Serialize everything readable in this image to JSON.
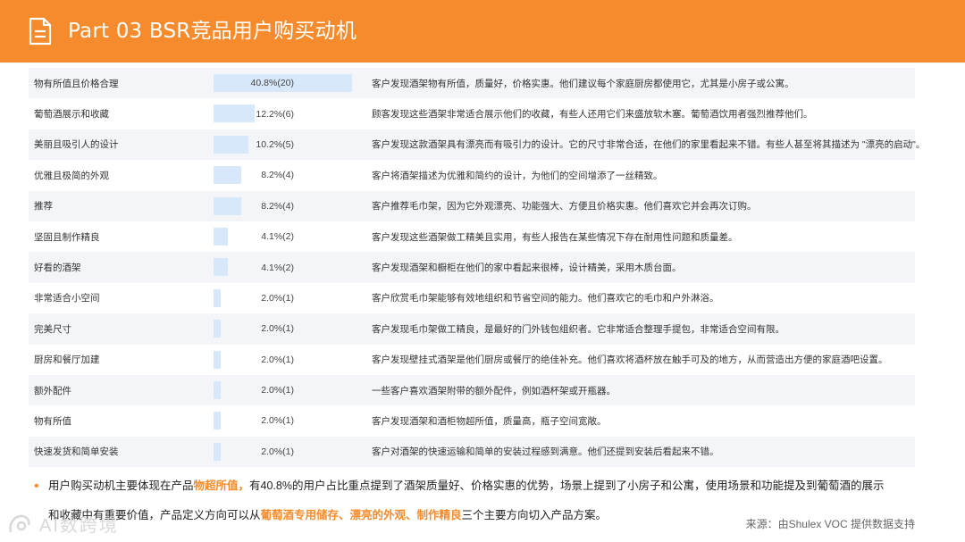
{
  "header": {
    "title": "Part 03  BSR竞品用户购买动机",
    "icon": "document-icon",
    "bg_color": "#f58b2c"
  },
  "rows": [
    {
      "feature": "物有所值且价格合理",
      "percent": 40.8,
      "label": "40.8%(20)",
      "desc": "客户发现酒架物有所值，质量好，价格实惠。他们建议每个家庭厨房都使用它，尤其是小房子或公寓。"
    },
    {
      "feature": "葡萄酒展示和收藏",
      "percent": 12.2,
      "label": "12.2%(6)",
      "desc": "顾客发现这些酒架非常适合展示他们的收藏，有些人还用它们来盛放软木塞。葡萄酒饮用者强烈推荐他们。"
    },
    {
      "feature": "美丽且吸引人的设计",
      "percent": 10.2,
      "label": "10.2%(5)",
      "desc": "客户发现这款酒架具有漂亮而有吸引力的设计。它的尺寸非常合适，在他们的家里看起来不错。有些人甚至将其描述为 \"漂亮的启动\"。"
    },
    {
      "feature": "优雅且极简的外观",
      "percent": 8.2,
      "label": "8.2%(4)",
      "desc": "客户将酒架描述为优雅和简约的设计，为他们的空间增添了一丝精致。"
    },
    {
      "feature": "推荐",
      "percent": 8.2,
      "label": "8.2%(4)",
      "desc": "客户推荐毛巾架，因为它外观漂亮、功能强大、方便且价格实惠。他们喜欢它并会再次订购。"
    },
    {
      "feature": "坚固且制作精良",
      "percent": 4.1,
      "label": "4.1%(2)",
      "desc": "客户发现这些酒架做工精美且实用，有些人报告在某些情况下存在耐用性问题和质量差。"
    },
    {
      "feature": "好看的酒架",
      "percent": 4.1,
      "label": "4.1%(2)",
      "desc": "客户发现酒架和橱柜在他们的家中看起来很棒，设计精美，采用木质台面。"
    },
    {
      "feature": "非常适合小空间",
      "percent": 2.0,
      "label": "2.0%(1)",
      "desc": "客户欣赏毛巾架能够有效地组织和节省空间的能力。他们喜欢它的毛巾和户外淋浴。"
    },
    {
      "feature": "完美尺寸",
      "percent": 2.0,
      "label": "2.0%(1)",
      "desc": "客户发现毛巾架做工精良，是最好的门外钱包组织者。它非常适合整理手提包，非常适合空间有限。"
    },
    {
      "feature": "厨房和餐厅加建",
      "percent": 2.0,
      "label": "2.0%(1)",
      "desc": "客户发现壁挂式酒架是他们厨房或餐厅的绝佳补充。他们喜欢将酒杯放在触手可及的地方，从而营造出方便的家庭酒吧设置。"
    },
    {
      "feature": "额外配件",
      "percent": 2.0,
      "label": "2.0%(1)",
      "desc": "一些客户喜欢酒架附带的额外配件，例如酒杯架或开瓶器。"
    },
    {
      "feature": "物有所值",
      "percent": 2.0,
      "label": "2.0%(1)",
      "desc": "客户发现酒架和酒柜物超所值，质量高，瓶子空间宽敞。"
    },
    {
      "feature": "快速发货和简单安装",
      "percent": 2.0,
      "label": "2.0%(1)",
      "desc": "客户对酒架的快速运输和简单的安装过程感到满意。他们还提到安装后看起来不错。"
    }
  ],
  "summary": {
    "bullet": "•",
    "l1_a": "用户购买动机主要体现在产品",
    "l1_hl": "物超所值，",
    "l1_b": "有40.8%的用户占比重点提到了酒架质量好、价格实惠的优势，场景上提到了小房子和公寓，使用场景和功能提及到葡萄酒的展示",
    "l2_a": "和收藏中有重要价值，产品定义方向可以从",
    "l2_hl": "葡萄酒专用储存、漂亮的外观、制作精良",
    "l2_b": "三个主要方向切入产品方案。"
  },
  "source": "来源：由Shulex VOC 提供数据支持",
  "watermark": "AI数跨境",
  "colors": {
    "accent": "#f58b2c",
    "bar": "#d6e8f9",
    "row_alt": "#f3f5f8"
  }
}
